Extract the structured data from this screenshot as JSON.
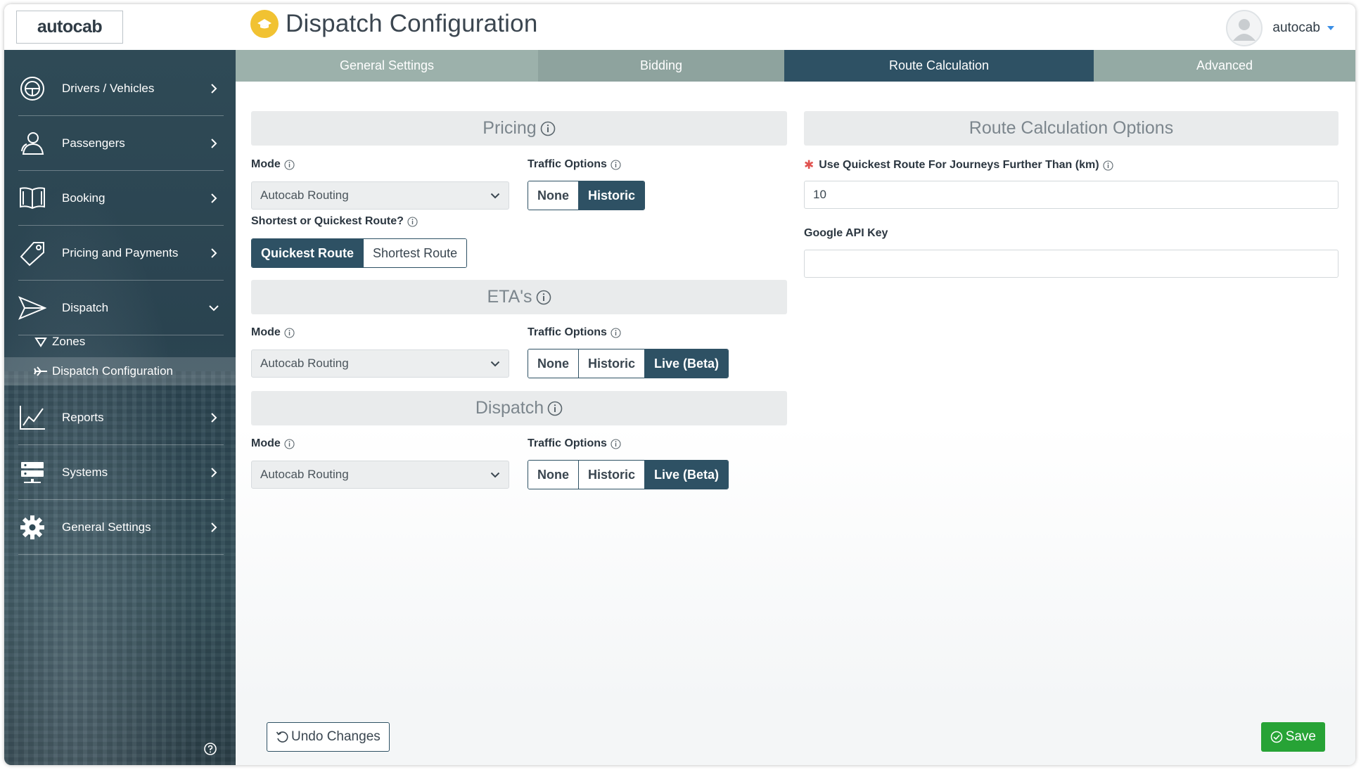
{
  "brand": {
    "logo_text": "autocab"
  },
  "header": {
    "title": "Dispatch Configuration",
    "username": "autocab"
  },
  "sidebar": {
    "items": [
      {
        "label": "Drivers / Vehicles",
        "icon": "steering-wheel-icon"
      },
      {
        "label": "Passengers",
        "icon": "users-icon"
      },
      {
        "label": "Booking",
        "icon": "book-icon"
      },
      {
        "label": "Pricing and Payments",
        "icon": "price-tag-icon"
      },
      {
        "label": "Dispatch",
        "icon": "paper-plane-icon",
        "expanded": true
      },
      {
        "label": "Reports",
        "icon": "line-chart-icon"
      },
      {
        "label": "Systems",
        "icon": "server-icon"
      },
      {
        "label": "General Settings",
        "icon": "gear-icon"
      }
    ],
    "subitems": [
      {
        "label": "Zones",
        "icon": "zone-icon"
      },
      {
        "label": "Dispatch Configuration",
        "icon": "plane-icon",
        "active": true
      }
    ]
  },
  "tabs": [
    {
      "label": "General Settings"
    },
    {
      "label": "Bidding"
    },
    {
      "label": "Route Calculation",
      "active": true
    },
    {
      "label": "Advanced"
    }
  ],
  "pricing": {
    "heading": "Pricing",
    "mode_label": "Mode",
    "mode_value": "Autocab Routing",
    "traffic_label": "Traffic Options",
    "traffic_options": [
      "None",
      "Historic"
    ],
    "traffic_selected": "Historic",
    "route_label": "Shortest or Quickest Route?",
    "route_options": [
      "Quickest Route",
      "Shortest Route"
    ],
    "route_selected": "Quickest Route"
  },
  "etas": {
    "heading": "ETA's",
    "mode_label": "Mode",
    "mode_value": "Autocab Routing",
    "traffic_label": "Traffic Options",
    "traffic_options": [
      "None",
      "Historic",
      "Live (Beta)"
    ],
    "traffic_selected": "Live (Beta)"
  },
  "dispatch": {
    "heading": "Dispatch",
    "mode_label": "Mode",
    "mode_value": "Autocab Routing",
    "traffic_label": "Traffic Options",
    "traffic_options": [
      "None",
      "Historic",
      "Live (Beta)"
    ],
    "traffic_selected": "Live (Beta)"
  },
  "route_options": {
    "heading": "Route Calculation Options",
    "quickest_label": "Use Quickest Route For Journeys Further Than (km)",
    "quickest_value": "10",
    "google_label": "Google API Key",
    "google_value": ""
  },
  "footer": {
    "undo_label": "Undo Changes",
    "save_label": "Save"
  },
  "colors": {
    "accent": "#2e5164",
    "sidebar": "#2f4a56",
    "save": "#27a336",
    "required": "#e0524f",
    "title_icon": "#f1c232"
  }
}
